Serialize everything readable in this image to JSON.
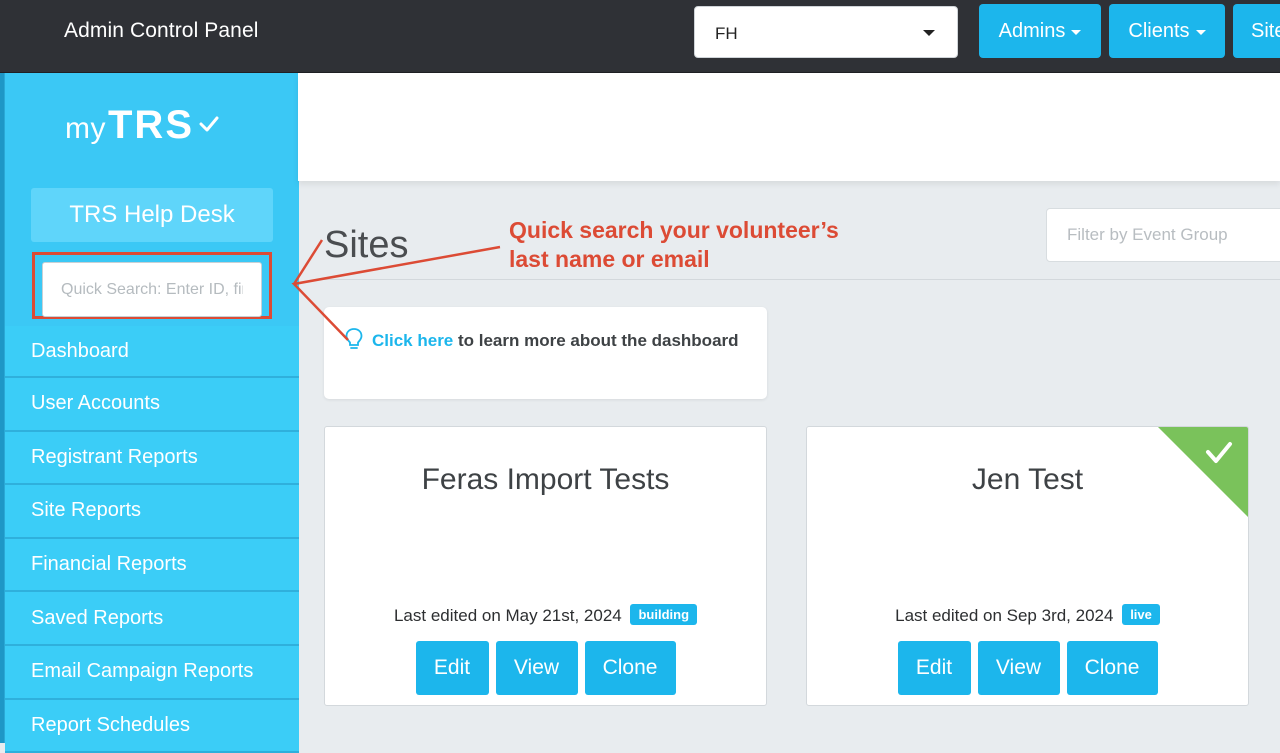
{
  "topbar": {
    "title": "Admin Control Panel",
    "account_select_value": "FH",
    "nav": {
      "admins": "Admins",
      "clients": "Clients",
      "sites": "Sites"
    }
  },
  "sidebar": {
    "logo_my": "my",
    "logo_trs": "TRS",
    "helpdesk_label": "TRS Help Desk",
    "search_placeholder": "Quick Search: Enter ID, first name, last name or email",
    "items": [
      {
        "label": "Dashboard"
      },
      {
        "label": "User Accounts"
      },
      {
        "label": "Registrant Reports"
      },
      {
        "label": "Site Reports"
      },
      {
        "label": "Financial Reports"
      },
      {
        "label": "Saved Reports"
      },
      {
        "label": "Email Campaign Reports"
      },
      {
        "label": "Report Schedules"
      }
    ]
  },
  "main": {
    "page_title": "Sites",
    "filter_placeholder": "Filter by Event Group",
    "tip": {
      "link": "Click here",
      "text": " to learn more about the dashboard"
    },
    "cards": [
      {
        "name": "Feras Import Tests",
        "edited": "Last edited on May 21st, 2024",
        "status": "building",
        "buttons": {
          "edit": "Edit",
          "view": "View",
          "clone": "Clone"
        }
      },
      {
        "name": "Jen Test",
        "edited": "Last edited on Sep 3rd, 2024",
        "status": "live",
        "buttons": {
          "edit": "Edit",
          "view": "View",
          "clone": "Clone"
        }
      }
    ]
  },
  "annotation": {
    "line1": "Quick search your volunteer’s",
    "line2": "last name or email"
  },
  "colors": {
    "accent": "#1cb6ec",
    "sidebar": "#3bc8f5",
    "topbar": "#2f3136",
    "annotation": "#dc4b35",
    "live_corner": "#7ac25b"
  },
  "icons": [
    "chevron-down-icon",
    "checkmark-icon",
    "lightbulb-icon",
    "arrow-annotation-icon"
  ]
}
